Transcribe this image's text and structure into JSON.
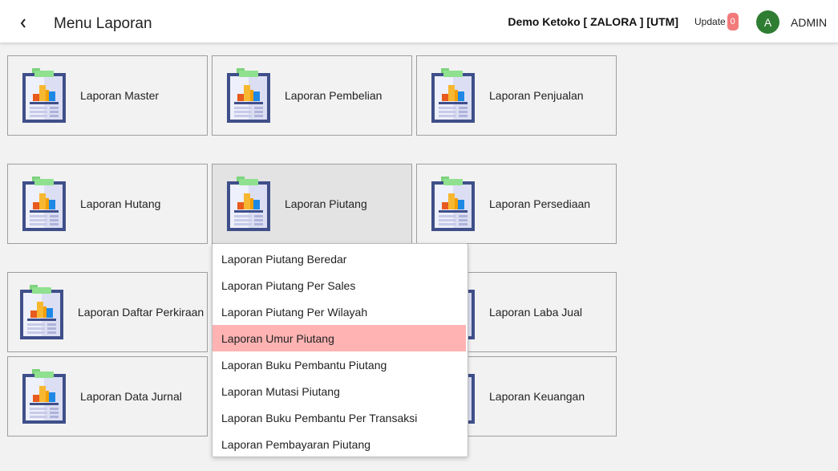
{
  "header": {
    "back_icon": "chevron-left-icon",
    "title": "Menu Laporan",
    "store": "Demo Ketoko [ ZALORA ] [UTM]",
    "update_label": "Update",
    "update_count": "0",
    "avatar_initial": "A",
    "user": "ADMIN"
  },
  "tiles": [
    {
      "label": "Laporan Master"
    },
    {
      "label": "Laporan Pembelian"
    },
    {
      "label": "Laporan Penjualan"
    },
    {
      "label": "Laporan Hutang"
    },
    {
      "label": "Laporan Piutang"
    },
    {
      "label": "Laporan Persediaan"
    },
    {
      "label": "Laporan Daftar Perkiraan"
    },
    {
      "label": "Laporan Laba Jual"
    },
    {
      "label": "Laporan Data Jurnal"
    },
    {
      "label": "Laporan Keuangan"
    }
  ],
  "tile_icon": "report-clipboard-icon",
  "active_tile": "Laporan Piutang",
  "dropdown": {
    "items": [
      "Laporan Piutang Beredar",
      "Laporan Piutang Per Sales",
      "Laporan Piutang Per Wilayah",
      "Laporan Umur Piutang",
      "Laporan Buku Pembantu Piutang",
      "Laporan Mutasi Piutang",
      "Laporan Buku Pembantu Per Transaksi",
      "Laporan Pembayaran Piutang"
    ],
    "highlighted": "Laporan Umur Piutang"
  },
  "colors": {
    "highlight": "#ffb3b3",
    "badge": "#f27a7a",
    "avatar": "#2e7d32",
    "icon_frame": "#3f4f8a"
  }
}
